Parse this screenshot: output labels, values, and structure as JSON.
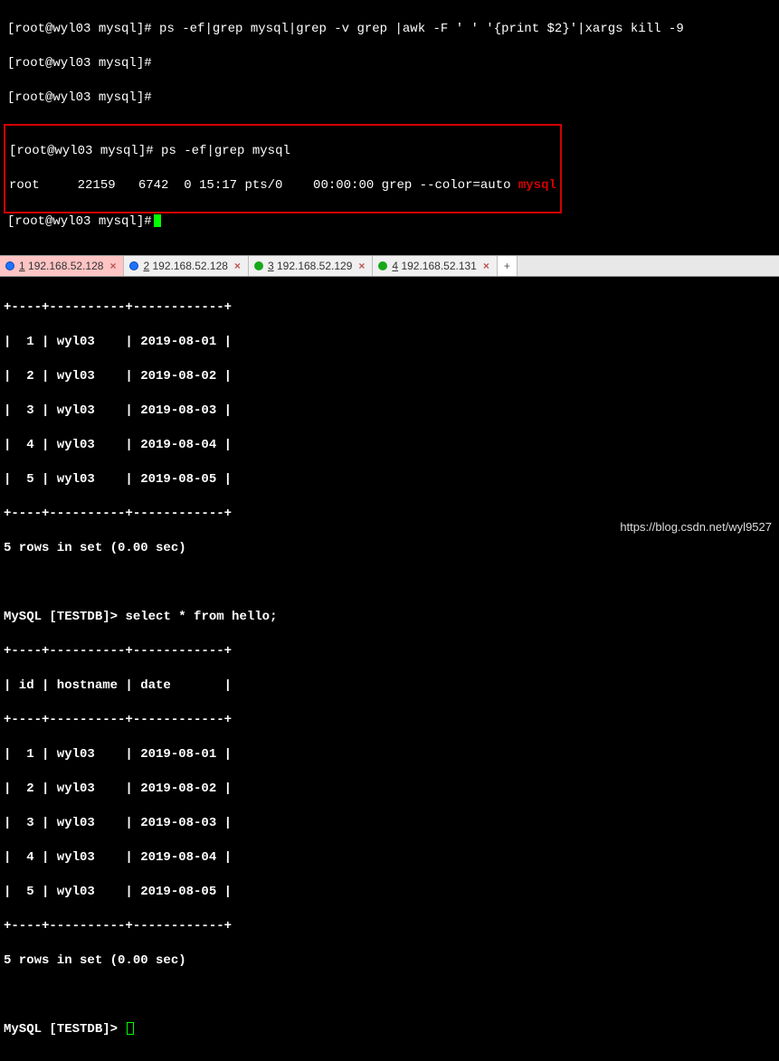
{
  "top": {
    "prompt": "[root@wyl03 mysql]#",
    "cmd1": " ps -ef|grep mysql|grep -v grep |awk -F ' ' '{print $2}'|xargs kill -9",
    "cmd_ps": "ps -ef|grep mysql",
    "ps_line_pre": "root     22159   6742  0 15:17 pts/0    00:00:00 grep --color=auto ",
    "ps_line_hl": "mysql"
  },
  "tabs": [
    {
      "status": "blue",
      "num": "1",
      "label": "192.168.52.128",
      "close": "×",
      "active": true
    },
    {
      "status": "blue",
      "num": "2",
      "label": "192.168.52.128",
      "close": "×",
      "active": false
    },
    {
      "status": "green",
      "num": "3",
      "label": "192.168.52.129",
      "close": "×",
      "active": false
    },
    {
      "status": "green",
      "num": "4",
      "label": "192.168.52.131",
      "close": "×",
      "active": false
    }
  ],
  "tab_add": "+",
  "bottom": {
    "border": "+----+----------+------------+",
    "header": "| id | hostname | date       |",
    "rows": [
      "|  1 | wyl03    | 2019-08-01 |",
      "|  2 | wyl03    | 2019-08-02 |",
      "|  3 | wyl03    | 2019-08-03 |",
      "|  4 | wyl03    | 2019-08-04 |",
      "|  5 | wyl03    | 2019-08-05 |"
    ],
    "summary": "5 rows in set (0.00 sec)",
    "prompt": "MySQL [TESTDB]>",
    "query": "select * from hello;"
  },
  "watermark": "https://blog.csdn.net/wyl9527"
}
